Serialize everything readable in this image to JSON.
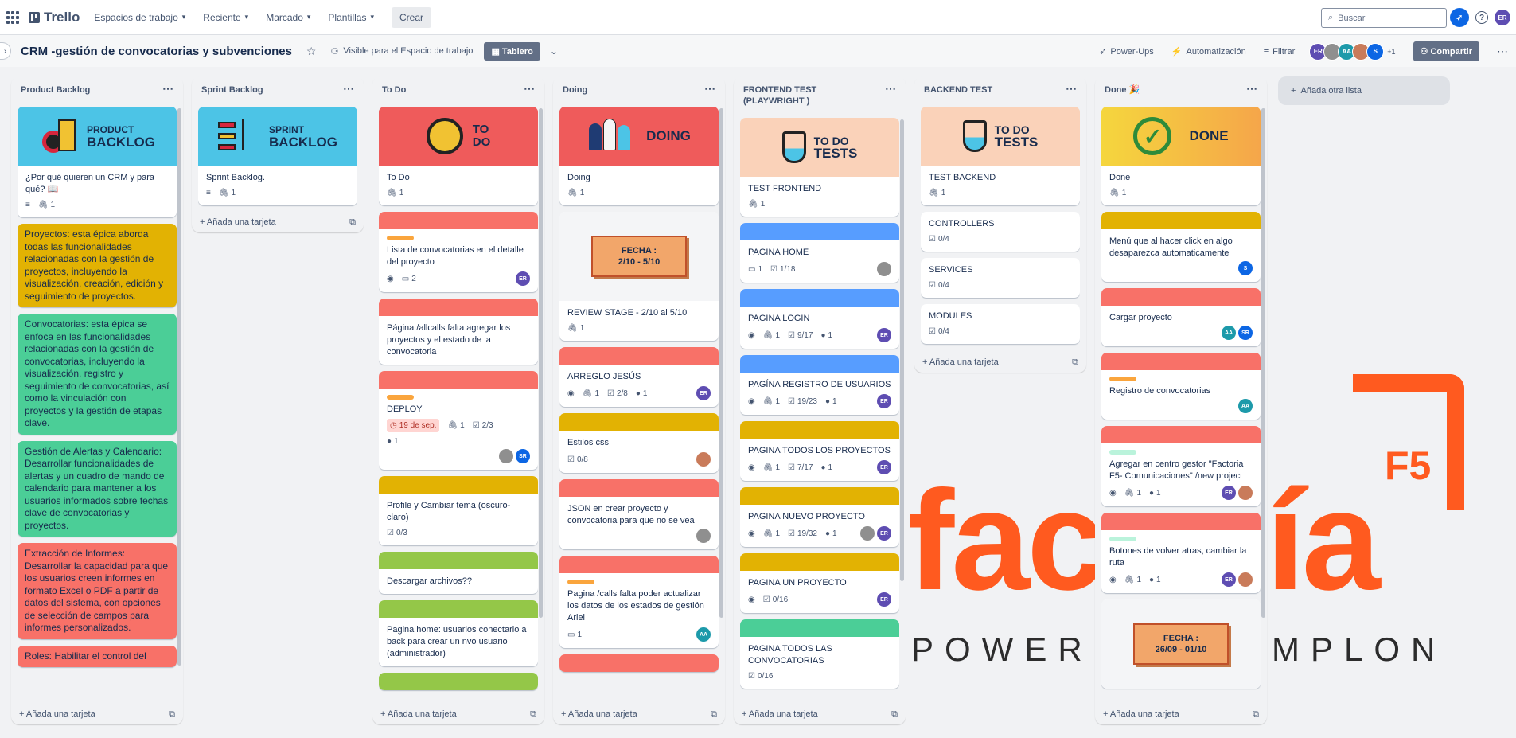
{
  "topbar": {
    "app_name": "Trello",
    "menus": [
      "Espacios de trabajo",
      "Reciente",
      "Marcado",
      "Plantillas"
    ],
    "create_label": "Crear",
    "search_placeholder": "Buscar",
    "user_initials": "ER"
  },
  "board": {
    "title": "CRM -gestión de convocatorias y subvenciones",
    "visibility": "Visible para el Espacio de trabajo",
    "view": "Tablero",
    "powerups": "Power-Ups",
    "automation": "Automatización",
    "filter": "Filtrar",
    "members": [
      "ER",
      "",
      "AA",
      "",
      "S"
    ],
    "members_extra": "+1",
    "share": "Compartir",
    "add_list": "Añada otra lista"
  },
  "add_card_label": "Añada una tarjeta",
  "lists": [
    {
      "title": "Product Backlog",
      "cover": {
        "l1": "PRODUCT",
        "l2": "BACKLOG"
      },
      "first_card": {
        "title": "¿Por qué quieren un CRM y para qué? 📖",
        "attachments": "1"
      },
      "epics": [
        {
          "text": "Proyectos: esta épica aborda todas las funcionalidades relacionadas con la gestión de proyectos, incluyendo la visualización, creación, edición y seguimiento de proyectos.",
          "color": "#e2b203"
        },
        {
          "text": "Convocatorias: esta épica se enfoca en las funcionalidades relacionadas con la gestión de convocatorias, incluyendo la visualización, registro y seguimiento de convocatorias, así como la vinculación con proyectos y la gestión de etapas clave.",
          "color": "#4bce97"
        },
        {
          "text": "Gestión de Alertas y Calendario: Desarrollar funcionalidades de alertas y un cuadro de mando de calendario para mantener a los usuarios informados sobre fechas clave de convocatorias y proyectos.",
          "color": "#4bce97"
        },
        {
          "text": "Extracción de Informes: Desarrollar la capacidad para que los usuarios creen informes en formato Excel o PDF a partir de datos del sistema, con opciones de selección de campos para informes personalizados.",
          "color": "#f87168"
        },
        {
          "text": "Roles: Habilitar el control del",
          "color": "#f87168"
        }
      ]
    },
    {
      "title": "Sprint Backlog",
      "cover": {
        "l1": "SPRINT",
        "l2": "BACKLOG"
      },
      "first_card": {
        "title": "Sprint Backlog.",
        "attachments": "1"
      }
    },
    {
      "title": "To Do",
      "cover": {
        "l1": "TO",
        "l2": "DO"
      },
      "first_card": {
        "title": "To Do",
        "attachments": "1"
      },
      "cards": [
        {
          "title": "Lista de convocatorias en el detalle del proyecto",
          "cover": "#f87168",
          "label": "#faa53d",
          "comments": "2",
          "avatar": "ER"
        },
        {
          "title": "Página /allcalls falta agregar los proyectos y el estado de la convocatoria",
          "cover": "#f87168"
        },
        {
          "title": "DEPLOY",
          "cover": "#f87168",
          "label": "#faa53d",
          "date": "19 de sep.",
          "attachments": "1",
          "checklist": "2/3",
          "github": "1",
          "avatar": "SR"
        },
        {
          "title": "Profile y Cambiar tema (oscuro-claro)",
          "cover": "#e2b203",
          "checklist": "0/3"
        },
        {
          "title": "Descargar archivos??",
          "cover": "#94c748"
        },
        {
          "title": "Pagina home: usuarios conectario a back para crear un nvo usuario (administrador)",
          "cover": "#94c748"
        }
      ]
    },
    {
      "title": "Doing",
      "cover": {
        "l1": "DOING",
        "l2": ""
      },
      "first_card": {
        "title": "Doing",
        "attachments": "1"
      },
      "review": {
        "sign_l1": "FECHA :",
        "sign_l2": "2/10 - 5/10",
        "title": "REVIEW STAGE - 2/10 al 5/10",
        "attachments": "1"
      },
      "cards": [
        {
          "title": "ARREGLO JESÚS",
          "cover": "#f87168",
          "attachments": "1",
          "checklist": "2/8",
          "github": "1",
          "avatar": "ER"
        },
        {
          "title": "Estilos css",
          "cover": "#e2b203",
          "checklist": "0/8"
        },
        {
          "title": "JSON en crear proyecto y convocatoria para que no se vea",
          "cover": "#f87168"
        },
        {
          "title": "Pagina /calls falta poder actualizar los datos de los estados de gestión Ariel",
          "cover": "#f87168",
          "label": "#faa53d",
          "comments": "1",
          "avatar": "AA"
        }
      ]
    },
    {
      "title": "FRONTEND TEST (PLAYWRIGHT )",
      "cover": {
        "l1": "TO DO",
        "l2": "TESTS"
      },
      "first_card": {
        "title": "TEST FRONTEND",
        "attachments": "1"
      },
      "cards": [
        {
          "title": "PAGINA HOME",
          "cover": "#579dff",
          "comments": "1",
          "checklist": "1/18"
        },
        {
          "title": "PAGINA LOGIN",
          "cover": "#579dff",
          "attachments": "1",
          "checklist": "9/17",
          "github": "1",
          "avatar": "ER"
        },
        {
          "title": "PAGÍNA REGISTRO DE USUARIOS",
          "cover": "#579dff",
          "attachments": "1",
          "checklist": "19/23",
          "github": "1",
          "avatar": "ER"
        },
        {
          "title": "PAGINA TODOS LOS PROYECTOS",
          "cover": "#e2b203",
          "attachments": "1",
          "checklist": "7/17",
          "github": "1",
          "avatar": "ER"
        },
        {
          "title": "PAGINA NUEVO PROYECTO",
          "cover": "#e2b203",
          "attachments": "1",
          "checklist": "19/32",
          "github": "1",
          "avatar": "ER"
        },
        {
          "title": "PAGINA UN PROYECTO",
          "cover": "#e2b203",
          "checklist": "0/16",
          "avatar": "ER"
        },
        {
          "title": "PAGINA TODOS LAS CONVOCATORIAS",
          "cover": "#4bce97",
          "checklist": "0/16"
        }
      ]
    },
    {
      "title": "BACKEND TEST",
      "cover": {
        "l1": "TO DO",
        "l2": "TESTS"
      },
      "first_card": {
        "title": "TEST BACKEND",
        "attachments": "1"
      },
      "cards": [
        {
          "title": "CONTROLLERS",
          "checklist": "0/4"
        },
        {
          "title": "SERVICES",
          "checklist": "0/4"
        },
        {
          "title": "MODULES",
          "checklist": "0/4"
        }
      ]
    },
    {
      "title": "Done 🎉",
      "cover": {
        "l1": "DONE",
        "l2": ""
      },
      "first_card": {
        "title": "Done",
        "attachments": "1"
      },
      "cards": [
        {
          "title": "Menú que al hacer click en algo desaparezca automaticamente",
          "cover": "#e2b203",
          "avatar": "S"
        },
        {
          "title": "Cargar proyecto",
          "cover": "#f87168",
          "avatar": "SR"
        },
        {
          "title": "Registro de convocatorias",
          "cover": "#f87168",
          "label": "#faa53d",
          "avatar": "AA"
        },
        {
          "title": "Agregar en centro gestor \"Factoria F5- Comunicaciones\" /new project",
          "cover": "#f87168",
          "label": "#baf3db",
          "attachments": "1",
          "github": "1",
          "avatar": "ER"
        },
        {
          "title": "Botones de volver atras, cambiar la ruta",
          "cover": "#f87168",
          "label": "#baf3db",
          "attachments": "1",
          "github": "1",
          "avatar": "ER"
        }
      ],
      "sign": {
        "l1": "FECHA :",
        "l2": "26/09 - 01/10"
      }
    }
  ],
  "background": {
    "brand_part1": "fac",
    "brand_part2": "ría",
    "badge": "F5",
    "tagline_part1": "POWERE",
    "tagline_part2": "MPLON",
    "brand_color": "#ff5a1f"
  }
}
